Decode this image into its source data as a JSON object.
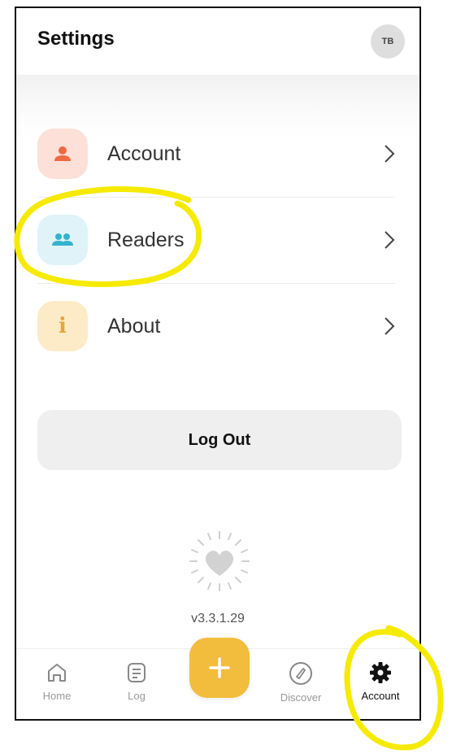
{
  "header": {
    "title": "Settings",
    "avatar_initials": "TB"
  },
  "menu": {
    "items": [
      {
        "label": "Account",
        "icon": "person-icon",
        "bg": "#fde0d8",
        "color": "#ee6a45"
      },
      {
        "label": "Readers",
        "icon": "people-icon",
        "bg": "#dff3f8",
        "color": "#34b3cc"
      },
      {
        "label": "About",
        "icon": "info-icon",
        "bg": "#fdebc8",
        "color": "#e5a63a",
        "glyph": "i"
      }
    ]
  },
  "logout_label": "Log Out",
  "version": "v3.3.1.29",
  "tabbar": {
    "items": [
      {
        "label": "Home",
        "icon": "home-icon"
      },
      {
        "label": "Log",
        "icon": "log-icon"
      },
      {
        "label": "",
        "icon": "plus-icon"
      },
      {
        "label": "Discover",
        "icon": "compass-icon"
      },
      {
        "label": "Account",
        "icon": "gear-icon",
        "active": true
      }
    ],
    "fab_glyph": "+"
  },
  "colors": {
    "fab": "#f2bd3c",
    "annotation": "#f5ea00"
  }
}
